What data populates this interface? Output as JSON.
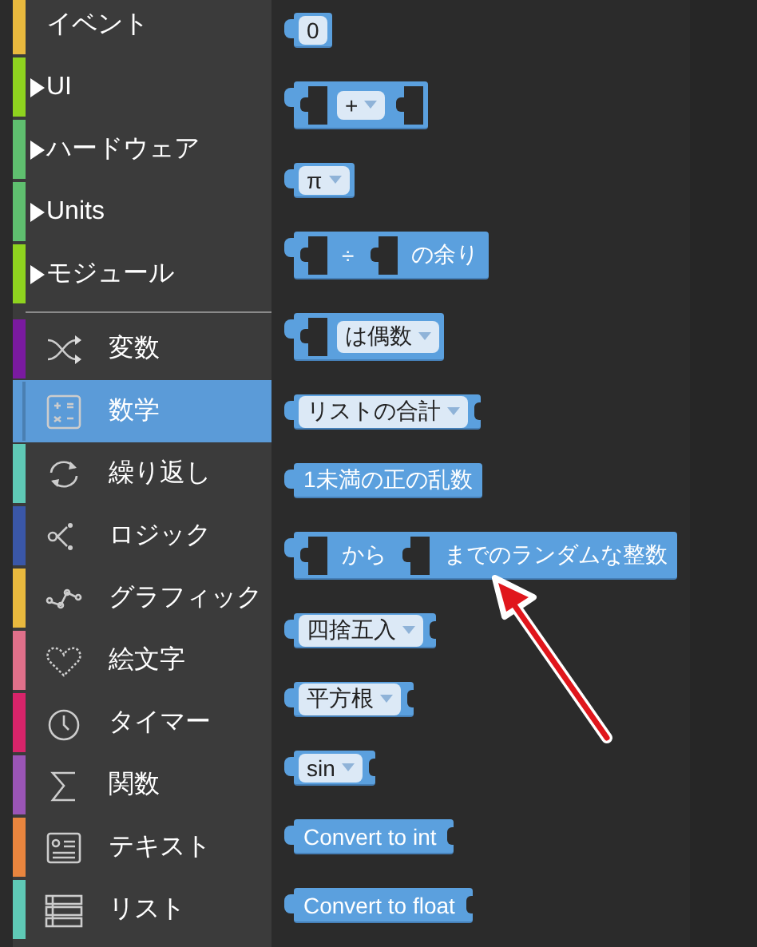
{
  "sidebar": {
    "groups": [
      {
        "kind": "plain",
        "items": [
          {
            "label": "イベント",
            "color": "#e9b93e",
            "expandable": false,
            "selected": false
          },
          {
            "label": "UI",
            "color": "#8fd31f",
            "expandable": true,
            "selected": false
          },
          {
            "label": "ハードウェア",
            "color": "#5fbf6f",
            "expandable": true,
            "selected": false
          },
          {
            "label": "Units",
            "color": "#5fbf6f",
            "expandable": true,
            "selected": false
          },
          {
            "label": "モジュール",
            "color": "#8fd31f",
            "expandable": true,
            "selected": false
          }
        ]
      },
      {
        "kind": "icons",
        "items": [
          {
            "label": "変数",
            "color": "#7a1aa0",
            "selected": false
          },
          {
            "label": "数学",
            "color": "#5b9bd8",
            "selected": true
          },
          {
            "label": "繰り返し",
            "color": "#5fc9b6",
            "selected": false
          },
          {
            "label": "ロジック",
            "color": "#3a57a8",
            "selected": false
          },
          {
            "label": "グラフィック",
            "color": "#e9b93e",
            "selected": false
          },
          {
            "label": "絵文字",
            "color": "#e0708a",
            "selected": false
          },
          {
            "label": "タイマー",
            "color": "#d8246a",
            "selected": false
          },
          {
            "label": "関数",
            "color": "#9a55b6",
            "selected": false
          },
          {
            "label": "テキスト",
            "color": "#e9853e",
            "selected": false
          },
          {
            "label": "リスト",
            "color": "#5fc9b6",
            "selected": false
          }
        ]
      }
    ]
  },
  "blocks": [
    {
      "parts": [
        {
          "kind": "field",
          "text": "0"
        }
      ]
    },
    {
      "parts": [
        {
          "kind": "slot"
        },
        {
          "kind": "dropdown",
          "text": "+"
        },
        {
          "kind": "slot"
        }
      ]
    },
    {
      "parts": [
        {
          "kind": "dropdown",
          "text": "π"
        }
      ]
    },
    {
      "parts": [
        {
          "kind": "slot"
        },
        {
          "kind": "label",
          "text": "÷"
        },
        {
          "kind": "slot"
        },
        {
          "kind": "label",
          "text": "の余り"
        }
      ]
    },
    {
      "parts": [
        {
          "kind": "slot"
        },
        {
          "kind": "dropdown",
          "text": "は偶数"
        }
      ]
    },
    {
      "parts": [
        {
          "kind": "dropdown",
          "text": "リストの合計"
        },
        {
          "kind": "notch"
        }
      ]
    },
    {
      "parts": [
        {
          "kind": "label",
          "text": "1未満の正の乱数"
        }
      ]
    },
    {
      "parts": [
        {
          "kind": "slot"
        },
        {
          "kind": "label",
          "text": "から"
        },
        {
          "kind": "slot"
        },
        {
          "kind": "label",
          "text": "までのランダムな整数"
        }
      ]
    },
    {
      "parts": [
        {
          "kind": "dropdown",
          "text": "四捨五入"
        },
        {
          "kind": "notch"
        }
      ]
    },
    {
      "parts": [
        {
          "kind": "dropdown",
          "text": "平方根"
        },
        {
          "kind": "notch"
        }
      ]
    },
    {
      "parts": [
        {
          "kind": "dropdown",
          "text": "sin"
        },
        {
          "kind": "notch"
        }
      ]
    },
    {
      "parts": [
        {
          "kind": "label",
          "text": "Convert to int"
        },
        {
          "kind": "notch"
        }
      ]
    },
    {
      "parts": [
        {
          "kind": "label",
          "text": "Convert to float"
        },
        {
          "kind": "notch"
        }
      ]
    }
  ]
}
